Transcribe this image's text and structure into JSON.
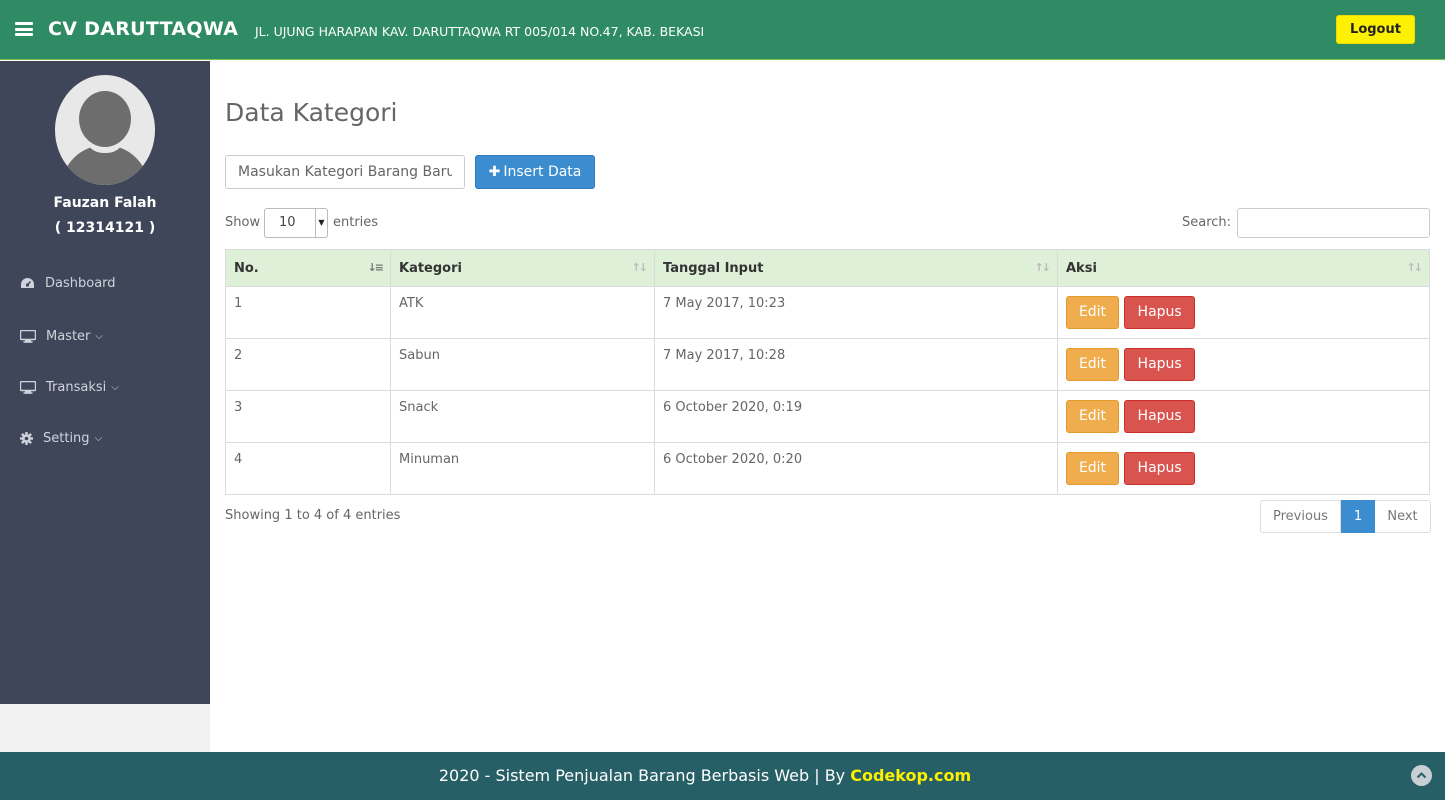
{
  "header": {
    "brand": "CV DARUTTAQWA",
    "address": "JL. UJUNG HARAPAN KAV. DARUTTAQWA RT 005/014 NO.47, KAB. BEKASI",
    "logout_label": "Logout",
    "color": "#2e8b64",
    "logout_color": "#fdf000"
  },
  "sidebar": {
    "user_name": "Fauzan Falah",
    "user_id": "( 12314121 )",
    "items": [
      {
        "label": "Dashboard",
        "icon": "dashboard-icon",
        "has_submenu": false
      },
      {
        "label": "Master",
        "icon": "desktop-icon",
        "has_submenu": true
      },
      {
        "label": "Transaksi",
        "icon": "desktop-icon",
        "has_submenu": true
      },
      {
        "label": "Setting",
        "icon": "gear-icon",
        "has_submenu": true
      }
    ],
    "color": "#404659"
  },
  "main": {
    "title": "Data Kategori",
    "new_category_placeholder": "Masukan Kategori Barang Baru",
    "insert_label": "Insert Data",
    "show_label": "Show",
    "entries_value": "10",
    "entries_label": "entries",
    "search_label": "Search:",
    "table": {
      "headers": [
        "No.",
        "Kategori",
        "Tanggal Input",
        "Aksi"
      ],
      "rows": [
        {
          "no": "1",
          "kategori": "ATK",
          "tanggal": "7 May 2017, 10:23"
        },
        {
          "no": "2",
          "kategori": "Sabun",
          "tanggal": "7 May 2017, 10:28"
        },
        {
          "no": "3",
          "kategori": "Snack",
          "tanggal": "6 October 2020, 0:19"
        },
        {
          "no": "4",
          "kategori": "Minuman",
          "tanggal": "6 October 2020, 0:20"
        }
      ],
      "edit_label": "Edit",
      "delete_label": "Hapus"
    },
    "info": "Showing 1 to 4 of 4 entries",
    "pagination": {
      "previous": "Previous",
      "current": "1",
      "next": "Next"
    }
  },
  "footer": {
    "text": "2020 - Sistem Penjualan Barang Berbasis Web | By ",
    "link": "Codekop.com",
    "color": "#265f66"
  }
}
